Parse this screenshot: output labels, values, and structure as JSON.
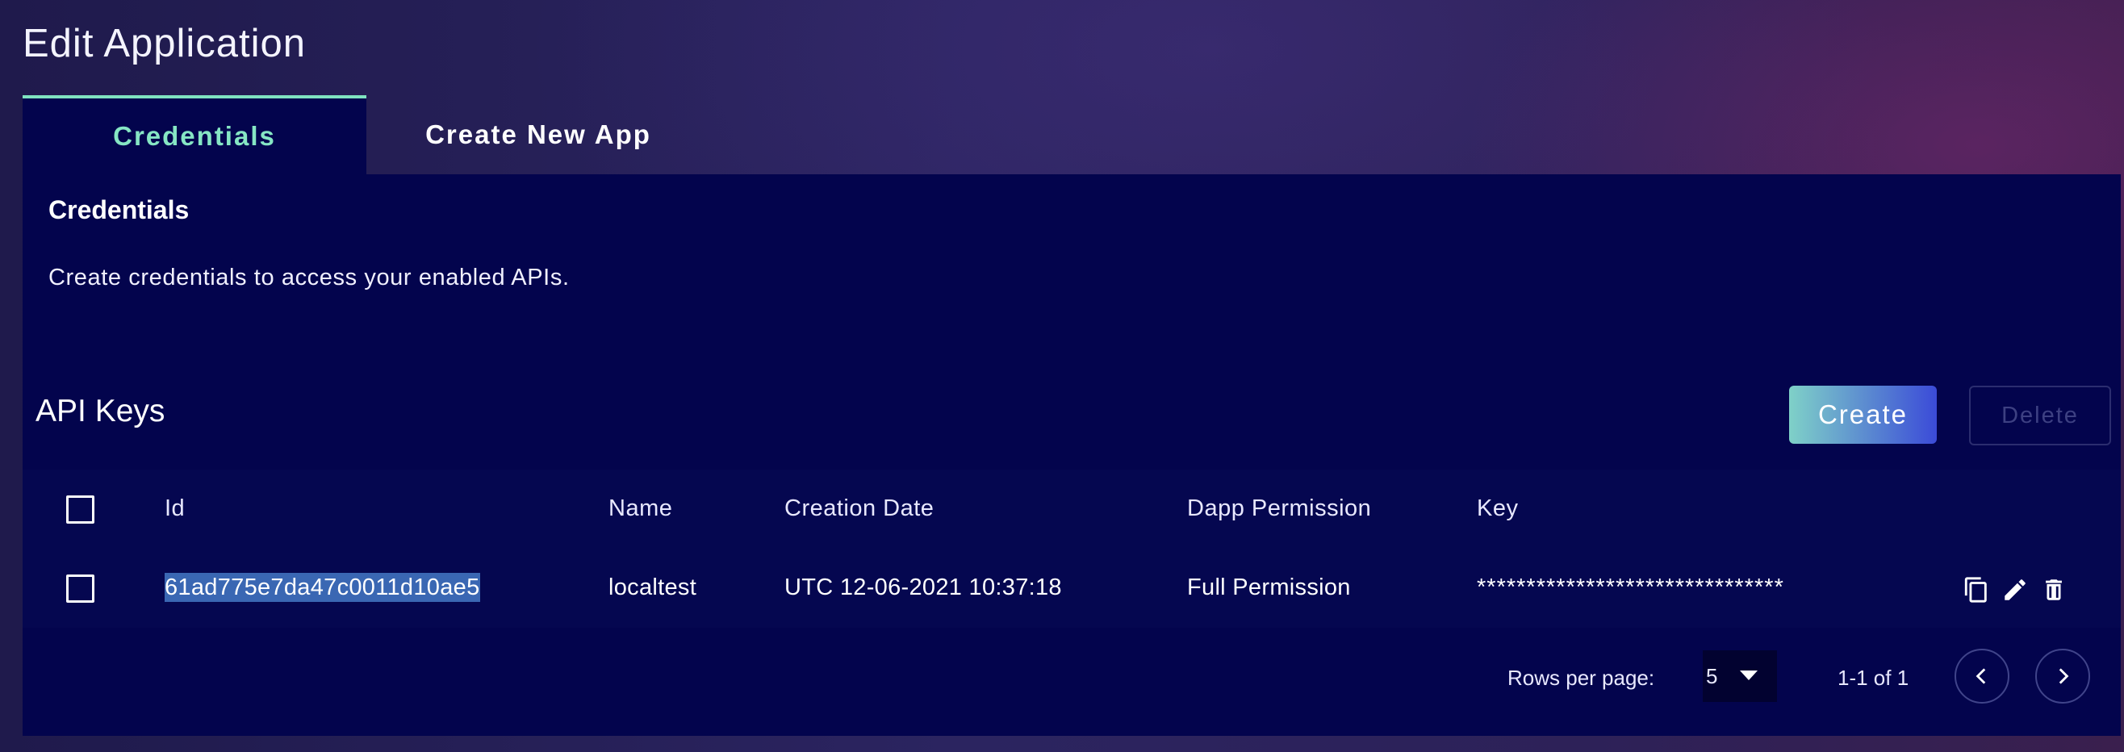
{
  "page": {
    "title": "Edit Application"
  },
  "tabs": [
    {
      "label": "Credentials",
      "active": true
    },
    {
      "label": "Create New App",
      "active": false
    }
  ],
  "credentials": {
    "heading": "Credentials",
    "description": "Create credentials to access your enabled APIs."
  },
  "api_keys": {
    "title": "API Keys",
    "create_label": "Create",
    "delete_label": "Delete",
    "columns": [
      "Id",
      "Name",
      "Creation Date",
      "Dapp Permission",
      "Key"
    ],
    "rows": [
      {
        "id": "61ad775e7da47c0011d10ae5",
        "name": "localtest",
        "creation_date": "UTC 12-06-2021 10:37:18",
        "permission": "Full Permission",
        "key": "*******************************",
        "actions": [
          "copy-icon",
          "edit-icon",
          "delete-icon"
        ]
      }
    ]
  },
  "pagination": {
    "rows_per_page_label": "Rows per page:",
    "rows_per_page_value": "5",
    "range_text": "1-1 of 1"
  },
  "colors": {
    "panel_bg": "#03044d",
    "accent_tab": "#86e6c4",
    "selection": "#3a67b3"
  }
}
